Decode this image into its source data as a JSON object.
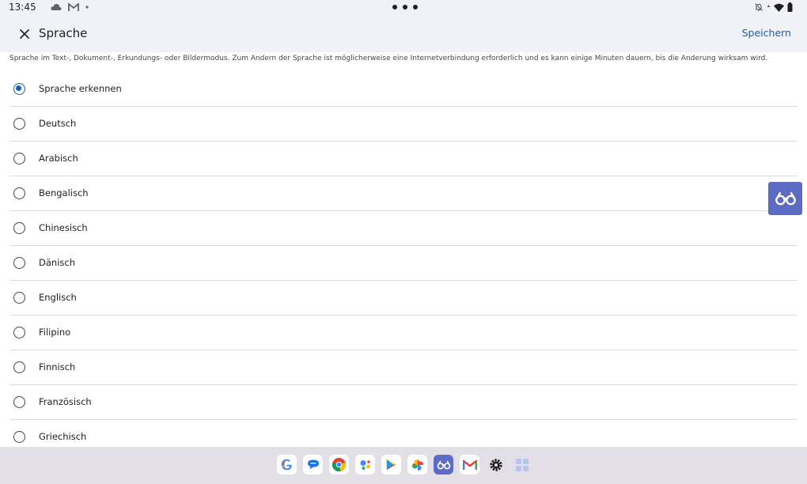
{
  "status_bar": {
    "time": "13:45"
  },
  "app_bar": {
    "title": "Sprache",
    "save_label": "Speichern",
    "close_icon": "close-icon"
  },
  "description": "Sprache im Text-, Dokument-, Erkundungs- oder Bildermodus. Zum Ändern der Sprache ist möglicherweise eine Internetverbindung erforderlich und es kann einige Minuten dauern, bis die Änderung wirksam wird.",
  "languages": [
    {
      "label": "Sprache erkennen",
      "selected": true
    },
    {
      "label": "Deutsch",
      "selected": false
    },
    {
      "label": "Arabisch",
      "selected": false
    },
    {
      "label": "Bengalisch",
      "selected": false
    },
    {
      "label": "Chinesisch",
      "selected": false
    },
    {
      "label": "Dänisch",
      "selected": false
    },
    {
      "label": "Englisch",
      "selected": false
    },
    {
      "label": "Filipino",
      "selected": false
    },
    {
      "label": "Finnisch",
      "selected": false
    },
    {
      "label": "Französisch",
      "selected": false
    },
    {
      "label": "Griechisch",
      "selected": false
    }
  ],
  "floating_button": {
    "icon": "binoculars-icon"
  },
  "dock": {
    "apps": [
      "google-icon",
      "messages-icon",
      "chrome-icon",
      "assistant-icon",
      "play-store-icon",
      "photos-icon",
      "lookout-icon",
      "gmail-icon",
      "settings-icon",
      "app-drawer-icon"
    ]
  },
  "colors": {
    "accent": "#1a5fb4",
    "bar_background": "#f0f2f7",
    "float_button": "#5d6bc4",
    "taskbar": "#e2dfe7"
  }
}
